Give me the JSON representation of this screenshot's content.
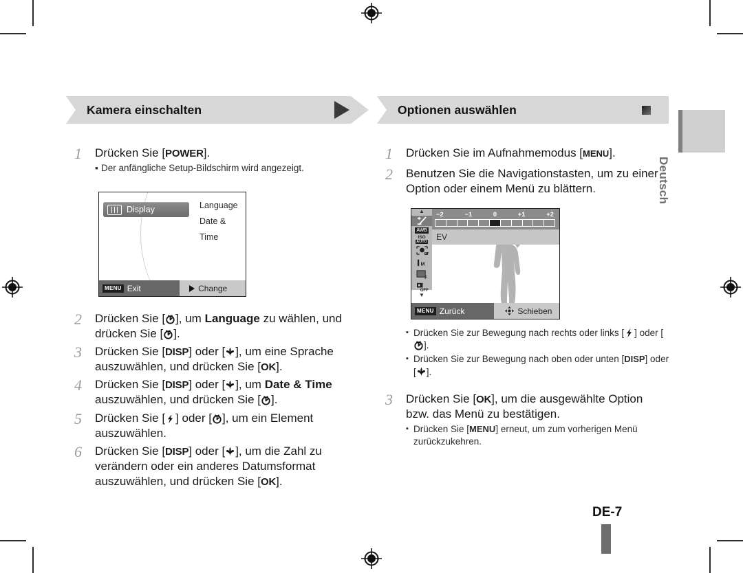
{
  "document": {
    "language_tab": "Deutsch",
    "page_number": "DE-7"
  },
  "left_column": {
    "header": {
      "title": "Kamera einschalten",
      "marker_icon": "triangle-right-icon"
    },
    "steps": [
      {
        "number": "1",
        "text_parts": [
          {
            "t": "Drücken Sie [",
            "style": "normal"
          },
          {
            "t": "POWER",
            "style": "key"
          },
          {
            "t": "].",
            "style": "normal"
          }
        ],
        "bullets": [
          "Der anfängliche Setup-Bildschirm wird angezeigt."
        ]
      },
      {
        "number": "2",
        "text_parts": [
          {
            "t": "Drücken Sie [",
            "style": "normal"
          },
          {
            "t": "timer-icon",
            "style": "icon"
          },
          {
            "t": "], um ",
            "style": "normal"
          },
          {
            "t": "Language",
            "style": "bold"
          },
          {
            "t": " zu wählen, und drücken Sie [",
            "style": "normal"
          },
          {
            "t": "timer-icon",
            "style": "icon"
          },
          {
            "t": "].",
            "style": "normal"
          }
        ],
        "bullets": []
      },
      {
        "number": "3",
        "text_parts": [
          {
            "t": "Drücken Sie [",
            "style": "normal"
          },
          {
            "t": "DISP",
            "style": "key"
          },
          {
            "t": "] oder [",
            "style": "normal"
          },
          {
            "t": "macro-icon",
            "style": "icon"
          },
          {
            "t": "], um eine Sprache auszuwählen, und drücken Sie [",
            "style": "normal"
          },
          {
            "t": "OK",
            "style": "key"
          },
          {
            "t": "].",
            "style": "normal"
          }
        ],
        "bullets": []
      },
      {
        "number": "4",
        "text_parts": [
          {
            "t": "Drücken Sie [",
            "style": "normal"
          },
          {
            "t": "DISP",
            "style": "key"
          },
          {
            "t": "] oder [",
            "style": "normal"
          },
          {
            "t": "macro-icon",
            "style": "icon"
          },
          {
            "t": "], um ",
            "style": "normal"
          },
          {
            "t": "Date & Time",
            "style": "bold"
          },
          {
            "t": " auszuwählen, und drücken Sie [",
            "style": "normal"
          },
          {
            "t": "timer-icon",
            "style": "icon"
          },
          {
            "t": "].",
            "style": "normal"
          }
        ],
        "bullets": []
      },
      {
        "number": "5",
        "text_parts": [
          {
            "t": "Drücken Sie [",
            "style": "normal"
          },
          {
            "t": "flash-icon",
            "style": "icon"
          },
          {
            "t": "] oder [",
            "style": "normal"
          },
          {
            "t": "timer-icon",
            "style": "icon"
          },
          {
            "t": "], um ein Element auszuwählen.",
            "style": "normal"
          }
        ],
        "bullets": []
      },
      {
        "number": "6",
        "text_parts": [
          {
            "t": "Drücken Sie [",
            "style": "normal"
          },
          {
            "t": "DISP",
            "style": "key"
          },
          {
            "t": "] oder [",
            "style": "normal"
          },
          {
            "t": "macro-icon",
            "style": "icon"
          },
          {
            "t": "], um die Zahl zu verändern oder ein anderes Datumsformat auszuwählen, und drücken Sie [",
            "style": "normal"
          },
          {
            "t": "OK",
            "style": "key"
          },
          {
            "t": "].",
            "style": "normal"
          }
        ],
        "bullets": []
      }
    ],
    "screen": {
      "selected_item": {
        "label": "Display",
        "icon": "display-icon"
      },
      "menu_options": [
        "Language",
        "Date & Time"
      ],
      "bottom_bar": {
        "left_badge": "MENU",
        "left_label": "Exit",
        "right_icon": "play-triangle-icon",
        "right_label": "Change"
      }
    }
  },
  "right_column": {
    "header": {
      "title": "Optionen auswählen",
      "marker_icon": "square-marker-icon"
    },
    "steps": [
      {
        "number": "1",
        "text_parts": [
          {
            "t": "Drücken Sie im Aufnahmemodus [",
            "style": "normal"
          },
          {
            "t": "MENU",
            "style": "keysm"
          },
          {
            "t": "].",
            "style": "normal"
          }
        ],
        "bullets": []
      },
      {
        "number": "2",
        "text_parts": [
          {
            "t": "Benutzen Sie die Navigationstasten, um zu einer Option oder einem Menü zu blättern.",
            "style": "normal"
          }
        ],
        "bullets": []
      },
      {
        "number": "3",
        "text_parts": [
          {
            "t": "Drücken Sie [",
            "style": "normal"
          },
          {
            "t": "OK",
            "style": "key"
          },
          {
            "t": "], um die ausgewählte Option bzw. das Menü zu bestätigen.",
            "style": "normal"
          }
        ],
        "bullets": []
      }
    ],
    "mid_bullets": [
      [
        {
          "t": "Drücken Sie zur Bewegung nach rechts oder links [",
          "style": "normal"
        },
        {
          "t": "flash-icon",
          "style": "icon"
        },
        {
          "t": "] oder [",
          "style": "normal"
        },
        {
          "t": "timer-icon",
          "style": "icon"
        },
        {
          "t": "].",
          "style": "normal"
        }
      ],
      [
        {
          "t": "Drücken Sie zur Bewegung nach oben oder unten [",
          "style": "normal"
        },
        {
          "t": "DISP",
          "style": "keysm"
        },
        {
          "t": "] oder [",
          "style": "normal"
        },
        {
          "t": "macro-icon",
          "style": "icon"
        },
        {
          "t": "].",
          "style": "normal"
        }
      ]
    ],
    "step3_bullets": [
      [
        {
          "t": "Drücken Sie [",
          "style": "normal"
        },
        {
          "t": "MENU",
          "style": "keysm"
        },
        {
          "t": "] erneut, um zum vorherigen Menü zurückzukehren.",
          "style": "normal"
        }
      ]
    ],
    "screen": {
      "ev_scale": {
        "labels": [
          "-2",
          "-1",
          "0",
          "+1",
          "+2"
        ],
        "segments": 11,
        "active_index": 5
      },
      "row_label": "EV",
      "sidebar_icons": [
        {
          "name": "ev-icon",
          "label": "EV",
          "active": true
        },
        {
          "name": "white-balance-icon",
          "label": "AWB",
          "active": false
        },
        {
          "name": "iso-icon",
          "label": "ISO",
          "active": false
        },
        {
          "name": "face-detect-off-icon",
          "label": "OFF",
          "active": false
        },
        {
          "name": "image-size-icon",
          "label": "M",
          "active": false
        },
        {
          "name": "quality-icon",
          "label": "F",
          "active": false
        },
        {
          "name": "frame-guide-off-icon",
          "label": "OFF",
          "active": false
        }
      ],
      "bottom_bar": {
        "left_badge": "MENU",
        "left_label": "Zurück",
        "right_icon": "dpad-icon",
        "right_label": "Schieben"
      }
    }
  }
}
